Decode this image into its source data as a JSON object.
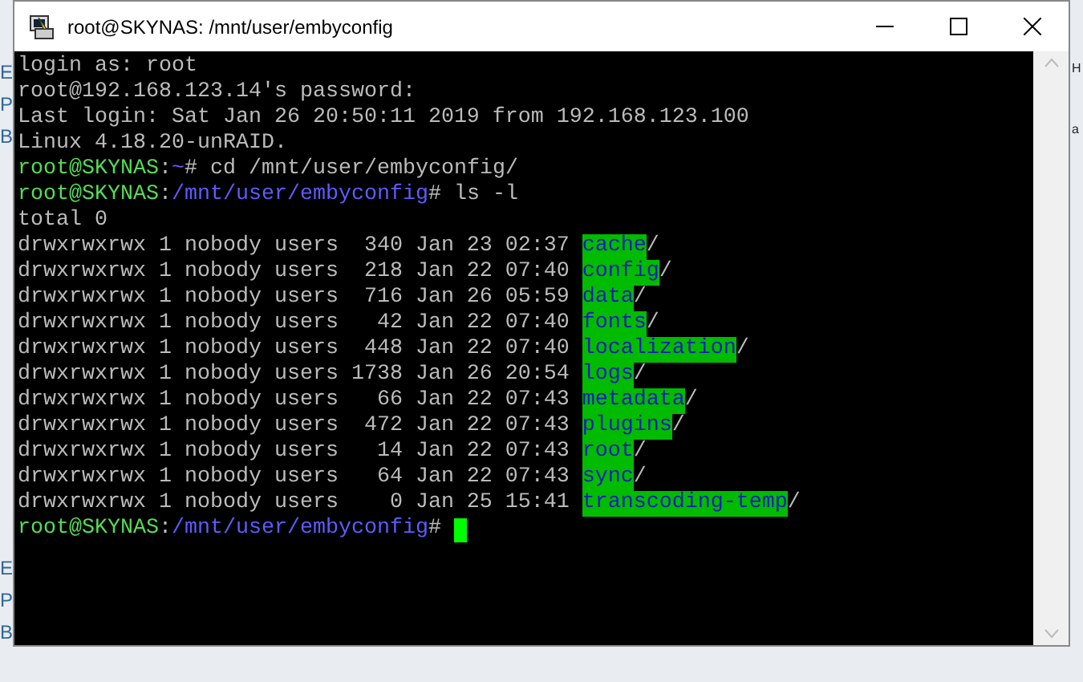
{
  "background": {
    "left_fragments": [
      "E",
      "P",
      "B",
      "E",
      "P",
      "B"
    ],
    "right_fragments": [
      "H",
      "a"
    ]
  },
  "window": {
    "title": "root@SKYNAS: /mnt/user/embyconfig"
  },
  "terminal": {
    "cursor": true,
    "lines": [
      [
        {
          "kind": "plain",
          "text": "login as: root"
        }
      ],
      [
        {
          "kind": "plain",
          "text": "root@192.168.123.14's password:"
        }
      ],
      [
        {
          "kind": "plain",
          "text": "Last login: Sat Jan 26 20:50:11 2019 from 192.168.123.100"
        }
      ],
      [
        {
          "kind": "plain",
          "text": "Linux 4.18.20-unRAID."
        }
      ],
      [
        {
          "kind": "host",
          "text": "root@SKYNAS"
        },
        {
          "kind": "plain",
          "text": ":"
        },
        {
          "kind": "path",
          "text": "~"
        },
        {
          "kind": "plain",
          "text": "# cd /mnt/user/embyconfig/"
        }
      ],
      [
        {
          "kind": "host",
          "text": "root@SKYNAS"
        },
        {
          "kind": "plain",
          "text": ":"
        },
        {
          "kind": "path",
          "text": "/mnt/user/embyconfig"
        },
        {
          "kind": "plain",
          "text": "# ls -l"
        }
      ],
      [
        {
          "kind": "plain",
          "text": "total 0"
        }
      ],
      [
        {
          "kind": "plain",
          "text": "drwxrwxrwx 1 nobody users  340 Jan 23 02:37 "
        },
        {
          "kind": "dir",
          "text": "cache"
        },
        {
          "kind": "plain",
          "text": "/"
        }
      ],
      [
        {
          "kind": "plain",
          "text": "drwxrwxrwx 1 nobody users  218 Jan 22 07:40 "
        },
        {
          "kind": "dir",
          "text": "config"
        },
        {
          "kind": "plain",
          "text": "/"
        }
      ],
      [
        {
          "kind": "plain",
          "text": "drwxrwxrwx 1 nobody users  716 Jan 26 05:59 "
        },
        {
          "kind": "dir",
          "text": "data"
        },
        {
          "kind": "plain",
          "text": "/"
        }
      ],
      [
        {
          "kind": "plain",
          "text": "drwxrwxrwx 1 nobody users   42 Jan 22 07:40 "
        },
        {
          "kind": "dir",
          "text": "fonts"
        },
        {
          "kind": "plain",
          "text": "/"
        }
      ],
      [
        {
          "kind": "plain",
          "text": "drwxrwxrwx 1 nobody users  448 Jan 22 07:40 "
        },
        {
          "kind": "dir",
          "text": "localization"
        },
        {
          "kind": "plain",
          "text": "/"
        }
      ],
      [
        {
          "kind": "plain",
          "text": "drwxrwxrwx 1 nobody users 1738 Jan 26 20:54 "
        },
        {
          "kind": "dir",
          "text": "logs"
        },
        {
          "kind": "plain",
          "text": "/"
        }
      ],
      [
        {
          "kind": "plain",
          "text": "drwxrwxrwx 1 nobody users   66 Jan 22 07:43 "
        },
        {
          "kind": "dir",
          "text": "metadata"
        },
        {
          "kind": "plain",
          "text": "/"
        }
      ],
      [
        {
          "kind": "plain",
          "text": "drwxrwxrwx 1 nobody users  472 Jan 22 07:43 "
        },
        {
          "kind": "dir",
          "text": "plugins"
        },
        {
          "kind": "plain",
          "text": "/"
        }
      ],
      [
        {
          "kind": "plain",
          "text": "drwxrwxrwx 1 nobody users   14 Jan 22 07:43 "
        },
        {
          "kind": "dir",
          "text": "root"
        },
        {
          "kind": "plain",
          "text": "/"
        }
      ],
      [
        {
          "kind": "plain",
          "text": "drwxrwxrwx 1 nobody users   64 Jan 22 07:43 "
        },
        {
          "kind": "dir",
          "text": "sync"
        },
        {
          "kind": "plain",
          "text": "/"
        }
      ],
      [
        {
          "kind": "plain",
          "text": "drwxrwxrwx 1 nobody users    0 Jan 25 15:41 "
        },
        {
          "kind": "dir",
          "text": "transcoding-temp"
        },
        {
          "kind": "plain",
          "text": "/"
        }
      ],
      [
        {
          "kind": "host",
          "text": "root@SKYNAS"
        },
        {
          "kind": "plain",
          "text": ":"
        },
        {
          "kind": "path",
          "text": "/mnt/user/embyconfig"
        },
        {
          "kind": "plain",
          "text": "# "
        }
      ]
    ]
  }
}
